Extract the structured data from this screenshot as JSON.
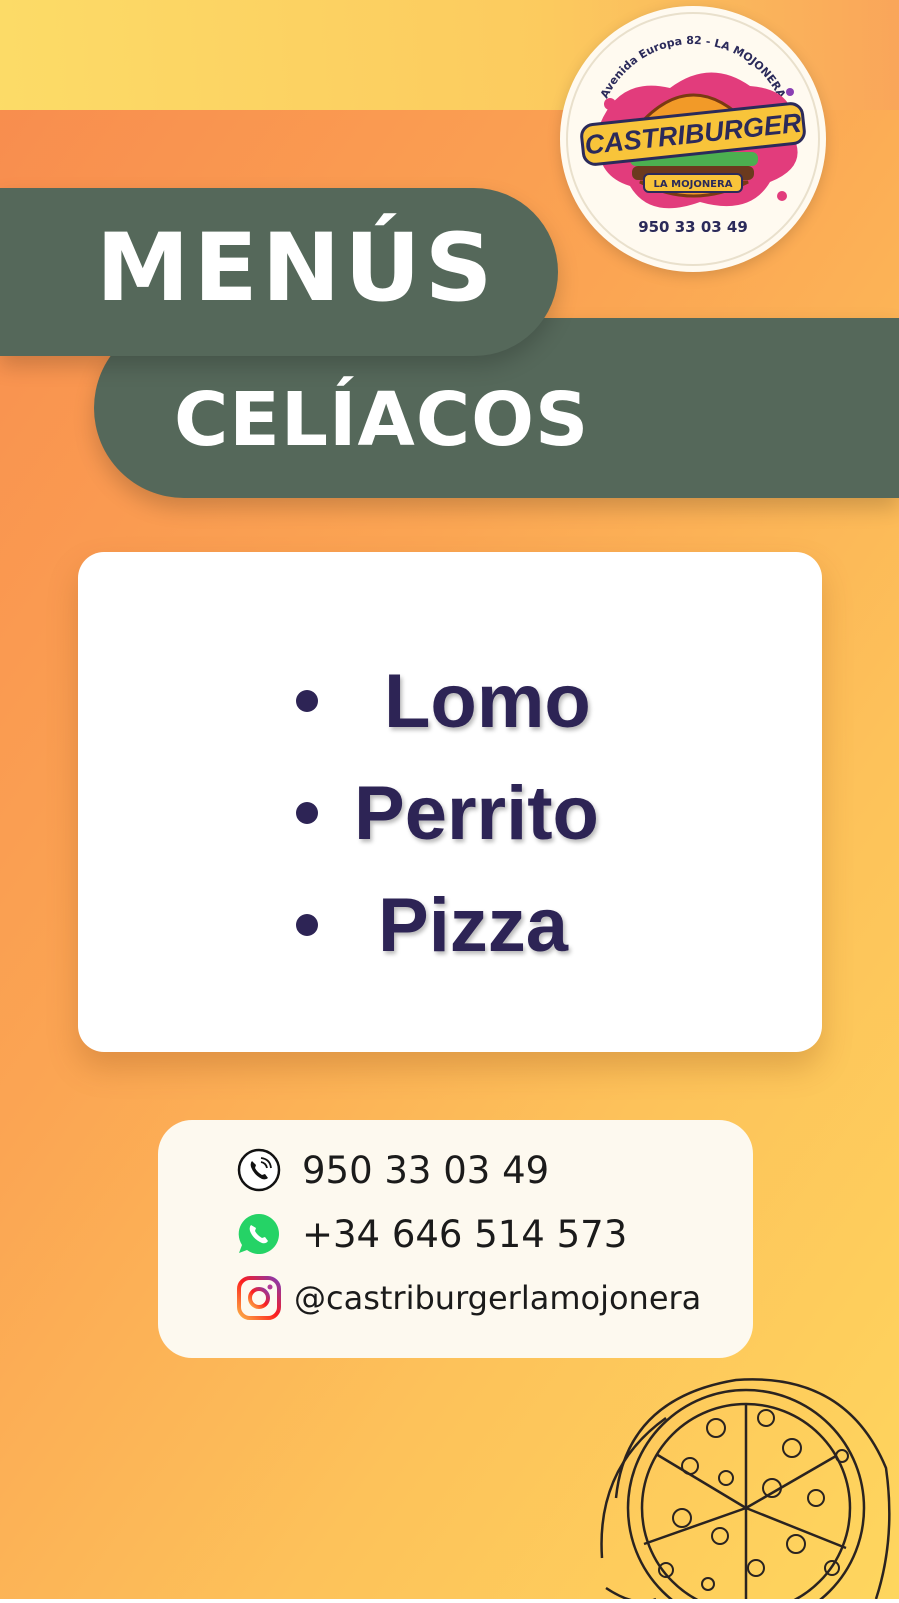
{
  "logo": {
    "ring_text": "Avenida Europa 82 - LA MOJONERA",
    "brand": "CASTRIBURGER",
    "location": "LA MOJONERA",
    "phone": "950 33 03 49"
  },
  "title": {
    "line1": "MENÚS",
    "line2": "CELÍACOS"
  },
  "menu": {
    "items": [
      {
        "label": "Lomo"
      },
      {
        "label": "Perrito"
      },
      {
        "label": "Pizza"
      }
    ]
  },
  "contact": {
    "phone": {
      "icon": "phone-icon",
      "value": "950 33 03 49"
    },
    "whatsapp": {
      "icon": "whatsapp-icon",
      "value": "+34 646 514 573"
    },
    "instagram": {
      "icon": "instagram-icon",
      "value": "@castriburgerlamojonera"
    }
  },
  "colors": {
    "banner": "#55685a",
    "menu_text": "#2d2455",
    "whatsapp": "#25d366",
    "bg_orange": "#f88b4e",
    "bg_yellow": "#fed65e"
  }
}
